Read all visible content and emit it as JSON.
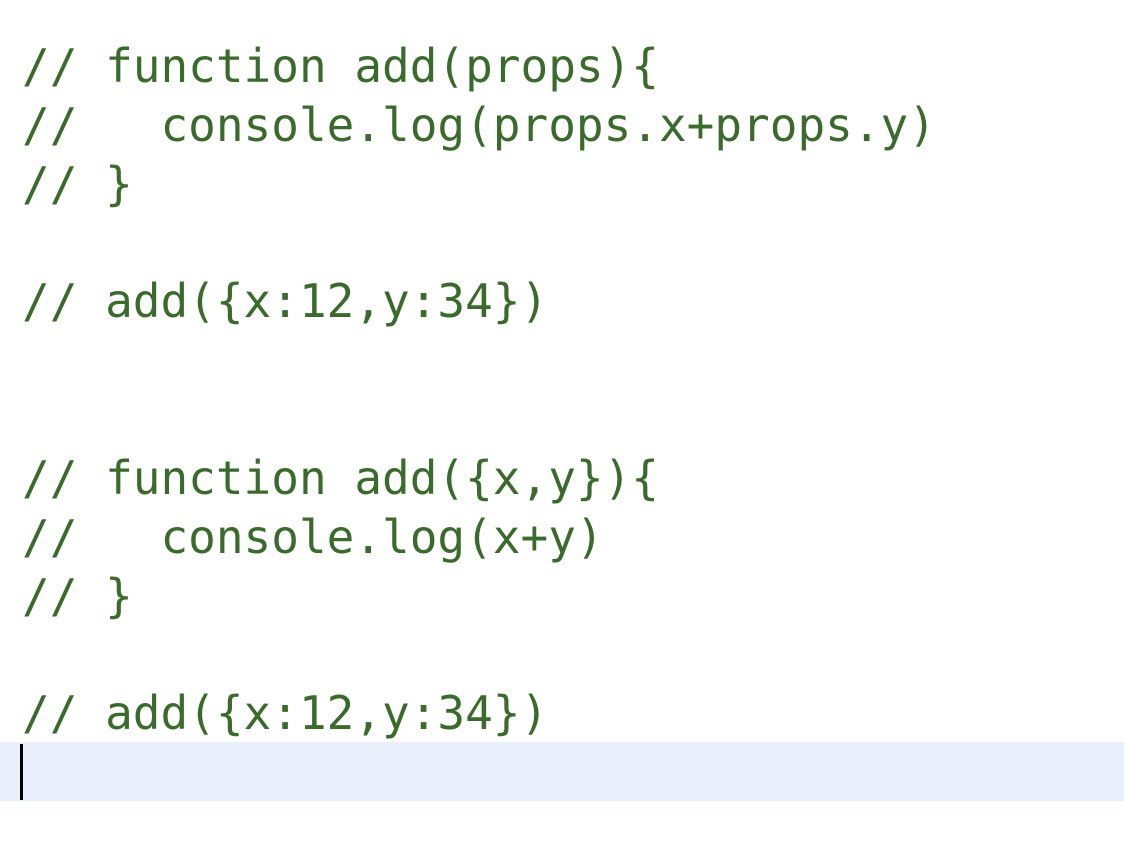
{
  "editor": {
    "lines": [
      "// function add(props){",
      "//   console.log(props.x+props.y)",
      "// }",
      "",
      "// add({x:12,y:34})",
      "",
      "",
      "// function add({x,y}){",
      "//   console.log(x+y)",
      "// }",
      "",
      "// add({x:12,y:34})",
      ""
    ],
    "comment_color": "#3a6b2c",
    "active_line_color": "#e9f0fb"
  }
}
